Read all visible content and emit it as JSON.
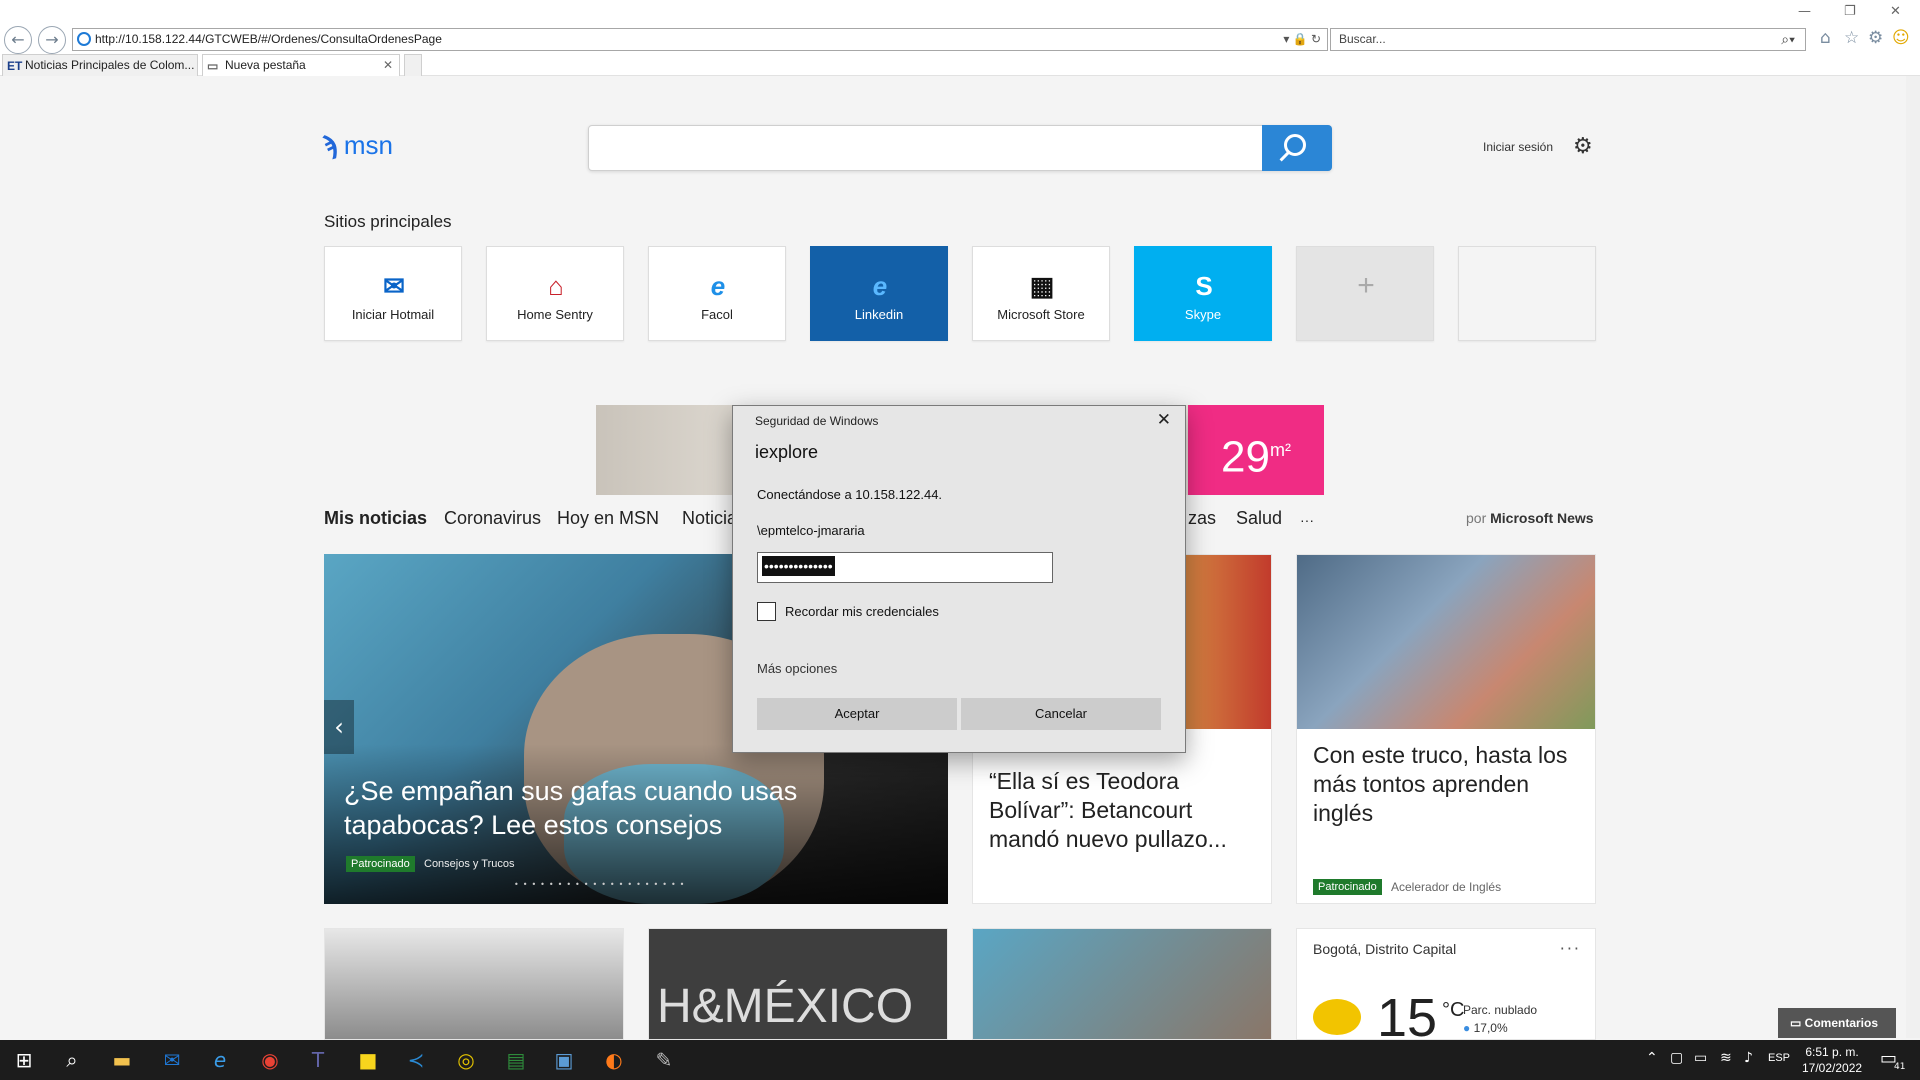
{
  "browser": {
    "url": "http://10.158.122.44/GTCWEB/#/Ordenes/ConsultaOrdenesPage",
    "search_placeholder": "Buscar...",
    "tabs": [
      {
        "favicon": "ET",
        "label": "Noticias Principales de Colom..."
      },
      {
        "label": "Nueva pestaña"
      }
    ]
  },
  "msn": {
    "logo": "msn",
    "signin": "Iniciar sesión",
    "sitios_title": "Sitios principales",
    "tiles": [
      {
        "label": "Iniciar Hotmail",
        "icon": "outlook-icon",
        "bg": "#ffffff"
      },
      {
        "label": "Home Sentry",
        "icon": "home-sentry-icon",
        "bg": "#ffffff"
      },
      {
        "label": "Facol",
        "icon": "ie-icon",
        "bg": "#ffffff"
      },
      {
        "label": "Linkedin",
        "icon": "ie-icon",
        "bg": "#1360a8"
      },
      {
        "label": "Microsoft Store",
        "icon": "store-icon",
        "bg": "#ffffff"
      },
      {
        "label": "Skype",
        "icon": "skype-icon",
        "bg": "#00aff0"
      },
      {
        "label": "",
        "icon": "plus-icon",
        "bg": "#e4e4e4"
      },
      {
        "label": "",
        "icon": "",
        "bg": "#f4f4f4"
      }
    ],
    "ad_text": "29",
    "ad_unit": "m²",
    "news_nav": [
      "Mis noticias",
      "Coronavirus",
      "Hoy en MSN",
      "Noticia",
      "zas",
      "Salud",
      "···"
    ],
    "por_label": "por",
    "por_brand": "Microsoft News",
    "hero": {
      "title": "¿Se empañan sus gafas cuando usas tapabocas? Lee estos consejos",
      "badge": "Patrocinado",
      "source": "Consejos y Trucos",
      "dots": "••••••••••••••••••••"
    },
    "card_teodora": {
      "title": "“Ella sí es Teodora Bolívar”: Betancourt mandó nuevo pullazo..."
    },
    "card_ingles": {
      "title": "Con este truco, hasta los más tontos aprenden inglés",
      "badge": "Patrocinado",
      "source": "Acelerador de Inglés"
    },
    "card_hm": {
      "text": "H&MÉXICO"
    },
    "weather": {
      "location": "Bogotá, Distrito Capital",
      "more": "···",
      "temp": "15",
      "unit": "°C",
      "condition": "Parc. nublado",
      "humidity": "17,0%"
    },
    "comentarios": "Comentarios"
  },
  "dialog": {
    "header": "Seguridad de Windows",
    "app": "iexplore",
    "connecting": "Conectándose a 10.158.122.44.",
    "username": "\\epmtelco-jmararia",
    "password_mask": "••••••••••••••",
    "remember_label": "Recordar mis credenciales",
    "remember_checked": false,
    "more_options": "Más opciones",
    "accept": "Aceptar",
    "cancel": "Cancelar"
  },
  "taskbar": {
    "time": "6:51 p. m.",
    "date": "17/02/2022",
    "lang": "ESP",
    "notifications": "41",
    "apps": [
      "start-icon",
      "search-icon",
      "file-explorer-icon",
      "outlook-icon",
      "internet-explorer-icon",
      "chrome-icon",
      "teams-icon",
      "sticky-notes-icon",
      "vscode-icon",
      "app-icon",
      "excel-icon",
      "powerapps-icon",
      "firefox-icon",
      "paint-icon"
    ]
  }
}
